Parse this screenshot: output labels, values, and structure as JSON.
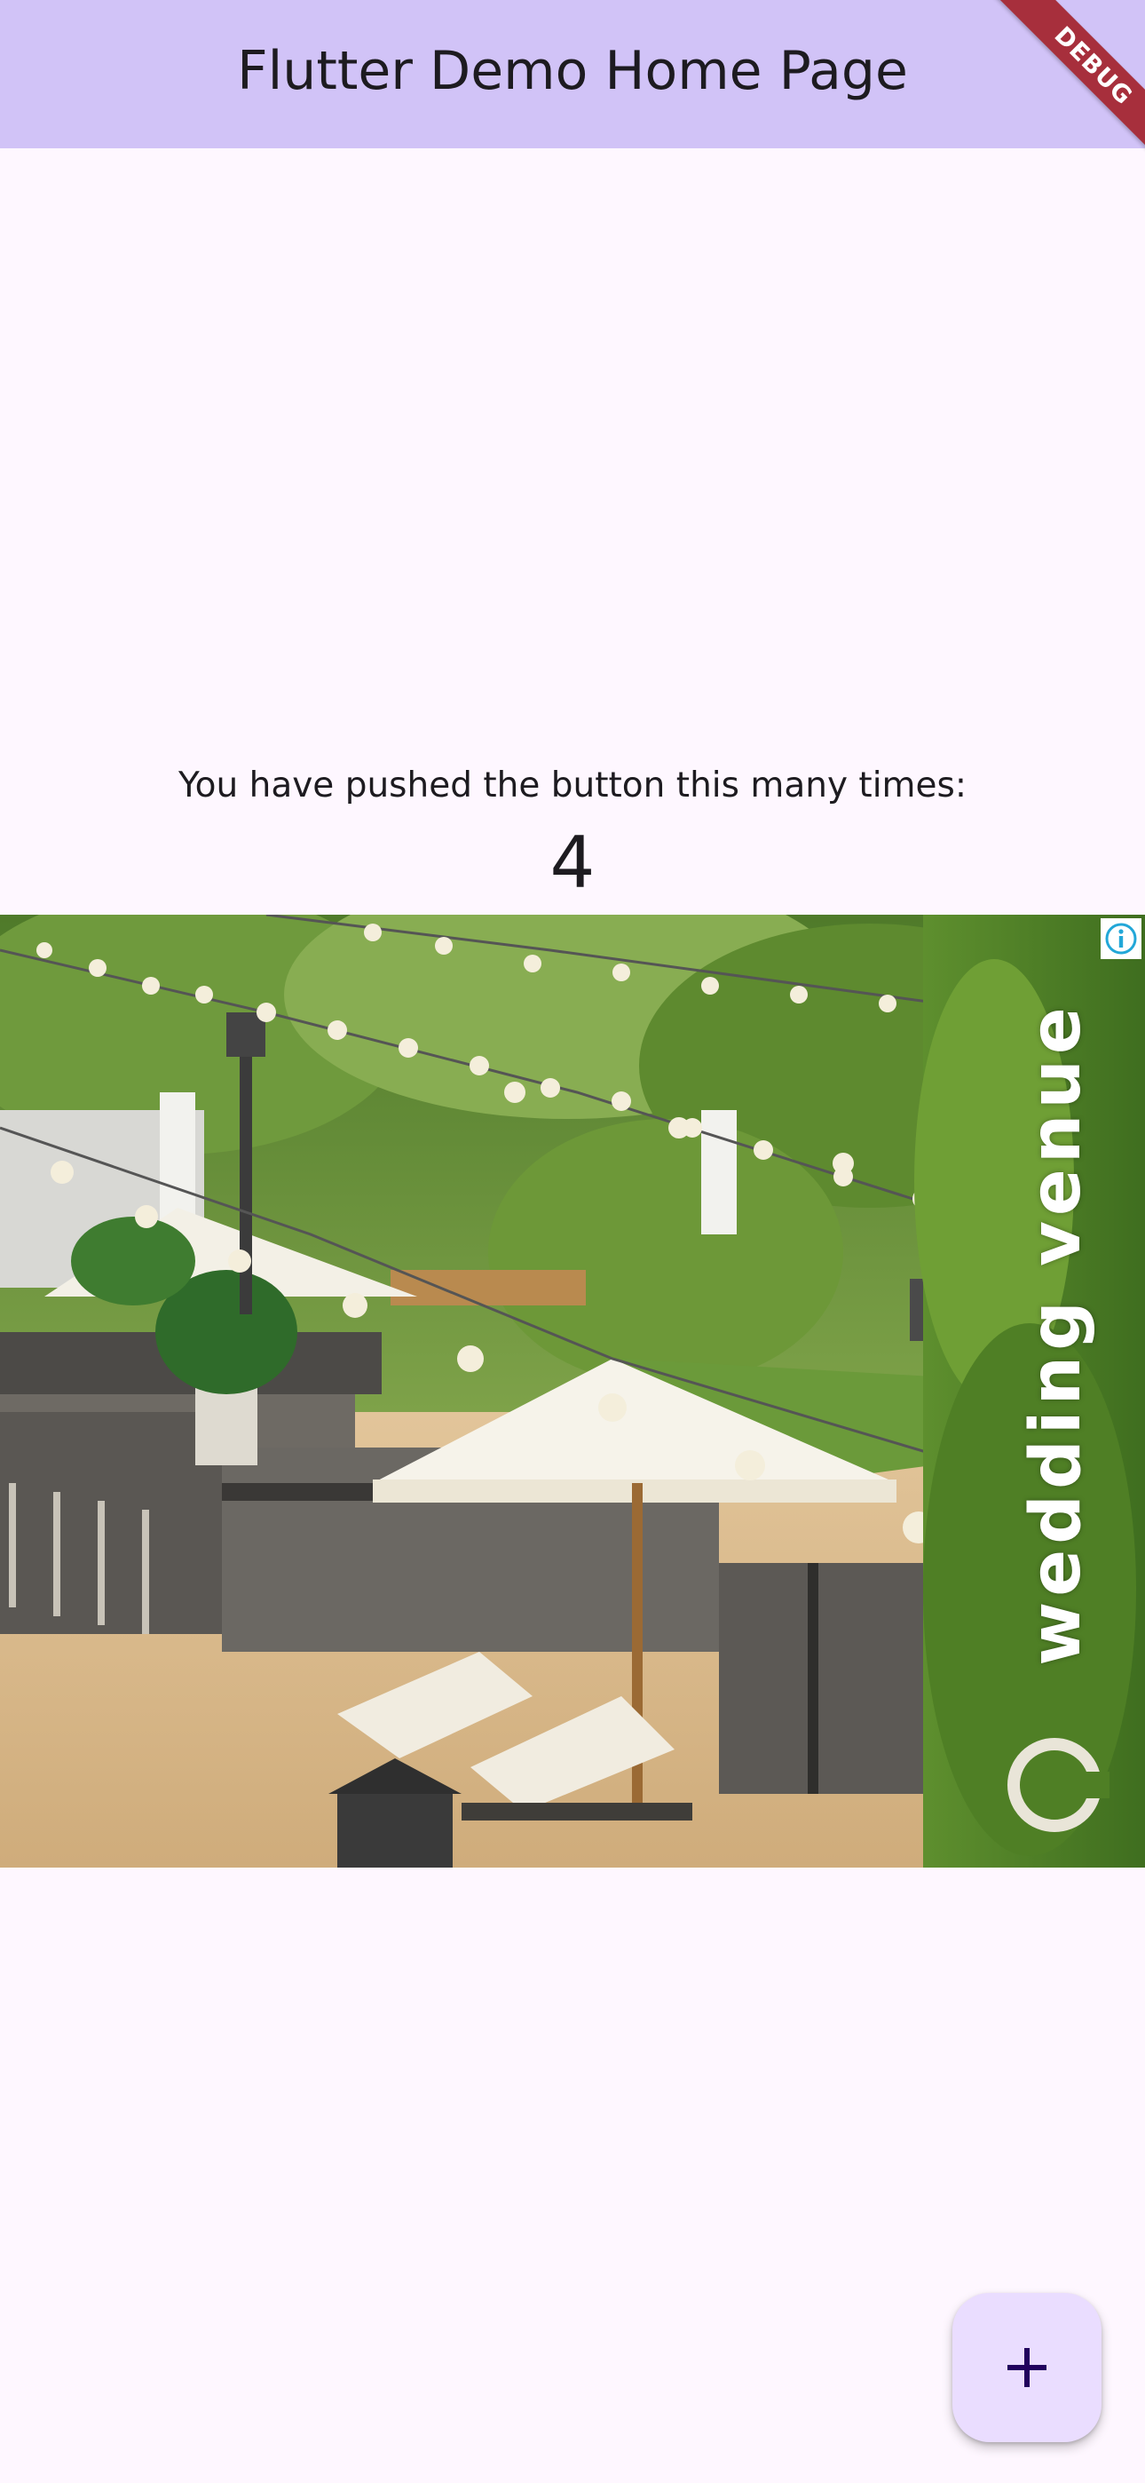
{
  "app_bar": {
    "title": "Flutter Demo Home Page",
    "background": "#d1c3f7"
  },
  "debug_banner": {
    "label": "DEBUG",
    "color": "#a72f3c"
  },
  "counter": {
    "label": "You have pushed the button this many times:",
    "value": "4"
  },
  "ad": {
    "text": "wedding venue",
    "info_icon": "info-icon"
  },
  "fab": {
    "icon": "plus-icon",
    "background": "#eaddff"
  },
  "colors": {
    "page_background": "#fef7ff",
    "text": "#1d1b20"
  }
}
